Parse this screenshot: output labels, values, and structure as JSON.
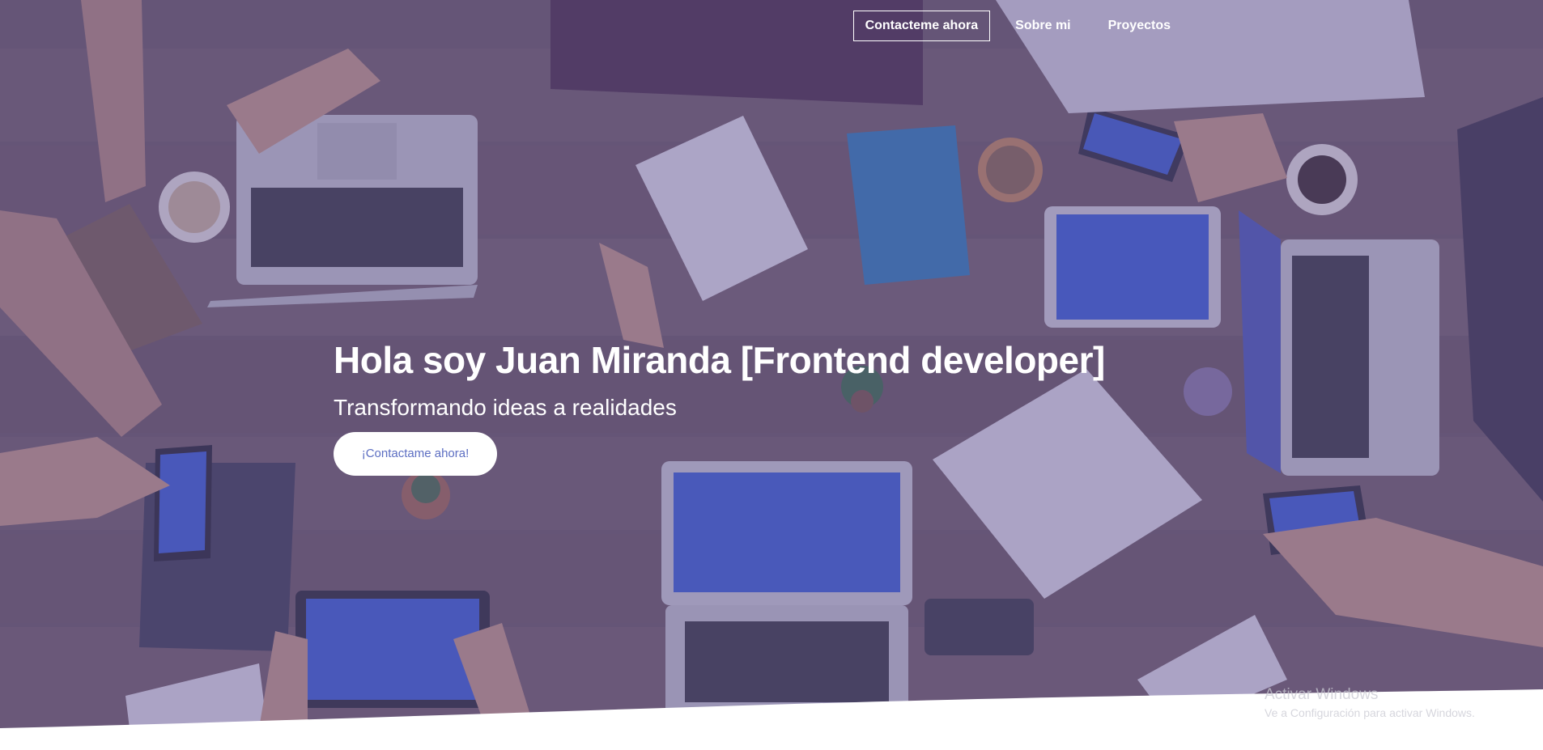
{
  "nav": {
    "items": [
      {
        "label": "Contacteme ahora",
        "active": true
      },
      {
        "label": "Sobre mi",
        "active": false
      },
      {
        "label": "Proyectos",
        "active": false
      }
    ]
  },
  "hero": {
    "title": "Hola soy Juan Miranda [Frontend developer]",
    "subtitle": "Transformando ideas a realidades",
    "cta_label": "¡Contactame ahora!",
    "accent_color": "#5c6ec2",
    "overlay_color": "#5c4e94"
  },
  "watermark": {
    "title": "Activar Windows",
    "subtitle": "Ve a Configuración para activar Windows."
  }
}
